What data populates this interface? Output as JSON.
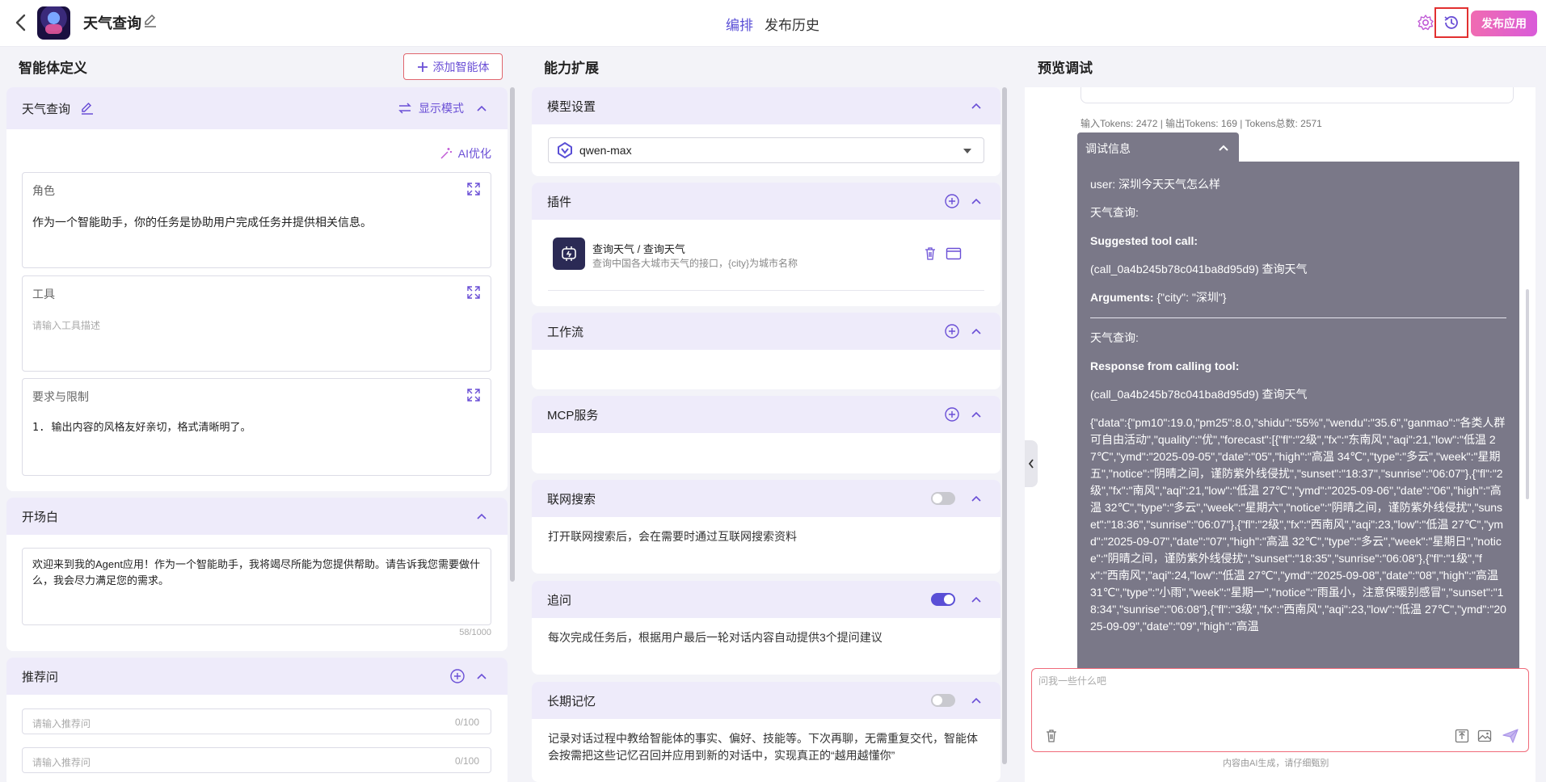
{
  "header": {
    "app_title": "天气查询",
    "tabs": [
      "编排",
      "发布历史"
    ],
    "publish_label": "发布应用"
  },
  "columns": {
    "left_title": "智能体定义",
    "add_agent_label": "添加智能体",
    "middle_title": "能力扩展",
    "right_title": "预览调试"
  },
  "agent": {
    "name": "天气查询",
    "mode_label": "显示模式",
    "ai_optimize_label": "AI优化",
    "role_label": "角色",
    "role_value": "作为一个智能助手，你的任务是协助用户完成任务并提供相关信息。",
    "tool_label": "工具",
    "tool_placeholder": "请输入工具描述",
    "req_label": "要求与限制",
    "req_value": "1. 输出内容的风格友好亲切，格式清晰明了。"
  },
  "opening": {
    "title": "开场白",
    "text": "欢迎来到我的Agent应用！作为一个智能助手，我将竭尽所能为您提供帮助。请告诉我您需要做什么，我会尽力满足您的需求。",
    "count": "58/1000"
  },
  "recommend": {
    "title": "推荐问",
    "placeholder": "请输入推荐问",
    "count": "0/100"
  },
  "model": {
    "title": "模型设置",
    "value": "qwen-max"
  },
  "plugins": {
    "title": "插件",
    "name": "查询天气 / 查询天气",
    "desc": "查询中国各大城市天气的接口，{city}为城市名称"
  },
  "workflow": {
    "title": "工作流"
  },
  "mcp": {
    "title": "MCP服务"
  },
  "web_search": {
    "title": "联网搜索",
    "enabled": false,
    "desc": "打开联网搜索后，会在需要时通过互联网搜索资料"
  },
  "followup": {
    "title": "追问",
    "enabled": true,
    "desc": "每次完成任务后，根据用户最后一轮对话内容自动提供3个提问建议"
  },
  "memory": {
    "title": "长期记忆",
    "enabled": false,
    "desc": "记录对话过程中教给智能体的事实、偏好、技能等。下次再聊，无需重复交代，智能体会按需把这些记忆召回并应用到新的对话中，实现真正的“越用越懂你”"
  },
  "preview": {
    "tokens": "输入Tokens: 2472 |  输出Tokens: 169 |  Tokens总数: 2571",
    "debug_title": "调试信息",
    "user_line": "user: 深圳今天天气怎么样",
    "agent_label": "天气查询:",
    "suggested_label": "Suggested tool call:",
    "call_line": "(call_0a4b245b78c041ba8d95d9) 查询天气",
    "arguments_label": "Arguments:",
    "arguments_value": " {\"city\": \"深圳\"}",
    "agent_label_2": "天气查询:",
    "response_label": "Response from calling tool:",
    "call_line_2": "(call_0a4b245b78c041ba8d95d9) 查询天气",
    "response_json": "{\"data\":{\"pm10\":19.0,\"pm25\":8.0,\"shidu\":\"55%\",\"wendu\":\"35.6\",\"ganmao\":\"各类人群可自由活动\",\"quality\":\"优\",\"forecast\":[{\"fl\":\"2级\",\"fx\":\"东南风\",\"aqi\":21,\"low\":\"低温 27℃\",\"ymd\":\"2025-09-05\",\"date\":\"05\",\"high\":\"高温 34℃\",\"type\":\"多云\",\"week\":\"星期五\",\"notice\":\"阴晴之间，谨防紫外线侵扰\",\"sunset\":\"18:37\",\"sunrise\":\"06:07\"},{\"fl\":\"2级\",\"fx\":\"南风\",\"aqi\":21,\"low\":\"低温 27℃\",\"ymd\":\"2025-09-06\",\"date\":\"06\",\"high\":\"高温 32℃\",\"type\":\"多云\",\"week\":\"星期六\",\"notice\":\"阴晴之间，谨防紫外线侵扰\",\"sunset\":\"18:36\",\"sunrise\":\"06:07\"},{\"fl\":\"2级\",\"fx\":\"西南风\",\"aqi\":23,\"low\":\"低温 27℃\",\"ymd\":\"2025-09-07\",\"date\":\"07\",\"high\":\"高温 32℃\",\"type\":\"多云\",\"week\":\"星期日\",\"notice\":\"阴晴之间，谨防紫外线侵扰\",\"sunset\":\"18:35\",\"sunrise\":\"06:08\"},{\"fl\":\"1级\",\"fx\":\"西南风\",\"aqi\":24,\"low\":\"低温 27℃\",\"ymd\":\"2025-09-08\",\"date\":\"08\",\"high\":\"高温 31℃\",\"type\":\"小雨\",\"week\":\"星期一\",\"notice\":\"雨虽小，注意保暖别感冒\",\"sunset\":\"18:34\",\"sunrise\":\"06:08\"},{\"fl\":\"3级\",\"fx\":\"西南风\",\"aqi\":23,\"low\":\"低温 27℃\",\"ymd\":\"2025-09-09\",\"date\":\"09\",\"high\":\"高温",
    "input_placeholder": "问我一些什么吧",
    "disclaimer": "内容由AI生成，请仔细甄别"
  },
  "colors": {
    "accent": "#5a4fd6",
    "section_header": "#eeebfa",
    "debug_bg": "#7a7888"
  }
}
